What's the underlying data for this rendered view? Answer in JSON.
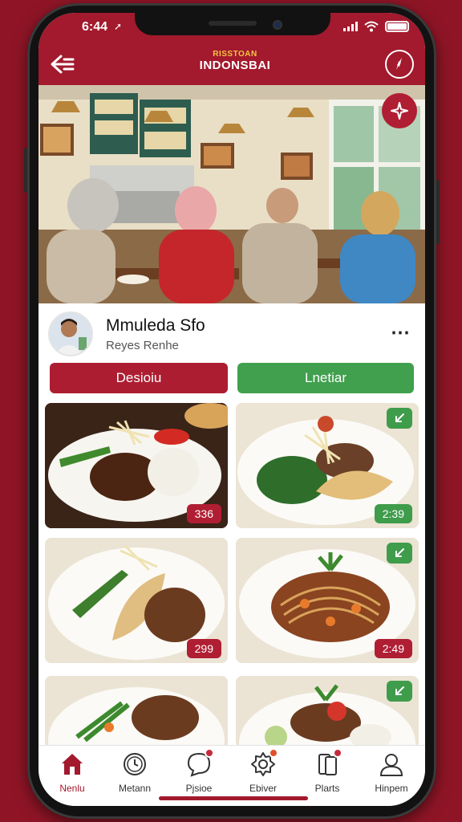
{
  "status": {
    "time": "6:44"
  },
  "appbar": {
    "logo_line1": "RISSTOAN",
    "logo_line2": "INDONSBAI"
  },
  "profile": {
    "name": "Mmuleda Sfo",
    "subtitle": "Reyes Renhe"
  },
  "actions": {
    "primary_label": "Desioiu",
    "secondary_label": "Lnetiar"
  },
  "dishes": [
    {
      "price": "336",
      "price_color": "#b01e33"
    },
    {
      "price": "2:39",
      "price_color": "#3f9c4b"
    },
    {
      "price": "299",
      "price_color": "#b01e33"
    },
    {
      "price": "2:49",
      "price_color": "#b01e33"
    },
    {
      "price": "",
      "price_color": ""
    },
    {
      "price": "",
      "price_color": ""
    }
  ],
  "tabs": [
    {
      "label": "Nenlu",
      "icon": "home-icon",
      "active": true
    },
    {
      "label": "Metann",
      "icon": "clock-icon"
    },
    {
      "label": "Pjsioe",
      "icon": "chat-icon",
      "badge": true
    },
    {
      "label": "Ebiver",
      "icon": "settings-icon",
      "badge": true
    },
    {
      "label": "Plarts",
      "icon": "phone-icon",
      "badge": true
    },
    {
      "label": "Hinpem",
      "icon": "profile-icon"
    }
  ],
  "colors": {
    "brand": "#a3192d",
    "accent_green": "#41a04e",
    "background": "#8f1526"
  }
}
